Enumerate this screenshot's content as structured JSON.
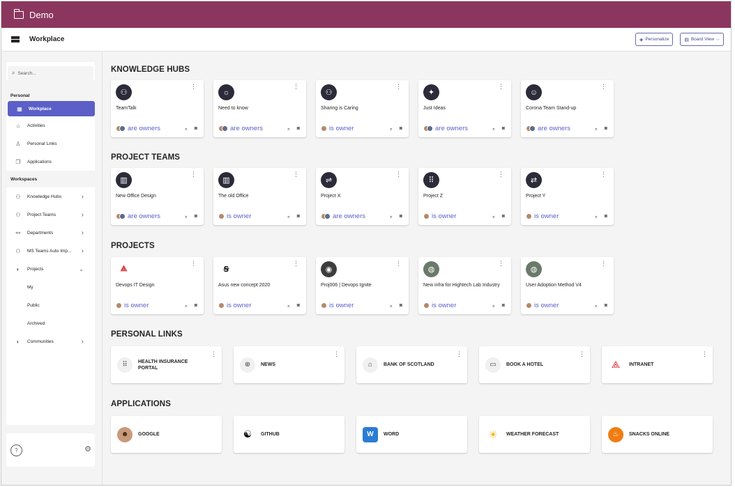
{
  "app": {
    "title": "Demo"
  },
  "header": {
    "title": "Workplace",
    "personalize_label": "Personalize",
    "board_view_label": "Board View"
  },
  "sidebar": {
    "search_placeholder": "Search...",
    "personal_label": "Personal",
    "personal_items": [
      {
        "label": "Workplace",
        "icon": "grid-icon"
      },
      {
        "label": "Activities",
        "icon": "home-icon"
      },
      {
        "label": "Personal Links",
        "icon": "person-icon"
      },
      {
        "label": "Applications",
        "icon": "copy-icon"
      }
    ],
    "workspaces_label": "Workspaces",
    "workspace_items": [
      {
        "label": "Knowledge Hubs",
        "icon": "teams-icon"
      },
      {
        "label": "Project Teams",
        "icon": "teams-icon"
      },
      {
        "label": "Departments",
        "icon": "org-icon"
      },
      {
        "label": "MS Teams Auto Imp...",
        "icon": "teams-icon"
      },
      {
        "label": "Projects",
        "icon": "planner-icon"
      }
    ],
    "project_subitems": [
      "My",
      "Public",
      "Archived"
    ],
    "communities_label": "Communities"
  },
  "sections": {
    "knowledge_hubs": {
      "title": "KNOWLEDGE HUBS",
      "cards": [
        {
          "name": "TeamTalk",
          "owner": "are owners",
          "icon": "group-icon"
        },
        {
          "name": "Need to know",
          "owner": "are owners",
          "icon": "lightbulb-head-icon"
        },
        {
          "name": "Sharing is Caring",
          "owner": "is owner",
          "icon": "group-icon"
        },
        {
          "name": "Just Ideas",
          "owner": "are owners",
          "icon": "lightbulb-icon"
        },
        {
          "name": "Corona Team Stand-up",
          "owner": "are owners",
          "icon": "face-mask-icon"
        }
      ]
    },
    "project_teams": {
      "title": "PROJECT TEAMS",
      "cards": [
        {
          "name": "New Office Design",
          "owner": "are owners",
          "icon": "building-icon"
        },
        {
          "name": "The old Office",
          "owner": "is owner",
          "icon": "building-icon"
        },
        {
          "name": "Project X",
          "owner": "are owners",
          "icon": "flow-icon"
        },
        {
          "name": "Project Z",
          "owner": "is owner",
          "icon": "grid-dots-icon"
        },
        {
          "name": "Project Y",
          "owner": "is owner",
          "icon": "swap-icon"
        }
      ]
    },
    "projects": {
      "title": "PROJECTS",
      "cards": [
        {
          "name": "Devops IT Design",
          "owner": "is owner",
          "icon": "rog-logo-icon"
        },
        {
          "name": "Asus new concept 2020",
          "owner": "is owner",
          "icon": "asus-logo-icon"
        },
        {
          "name": "Proj006 | Devops Ignite",
          "owner": "is owner",
          "icon": "disc-icon"
        },
        {
          "name": "New infra for Hightech Lab Industry",
          "owner": "is owner",
          "icon": "photo-icon"
        },
        {
          "name": "User Adoption Method V4",
          "owner": "is owner",
          "icon": "photo-icon"
        }
      ]
    },
    "personal_links": {
      "title": "PERSONAL LINKS",
      "items": [
        {
          "label": "HEALTH INSURANCE PORTAL",
          "icon": "dots-grid-icon"
        },
        {
          "label": "NEWS",
          "icon": "globe-icon"
        },
        {
          "label": "BANK OF SCOTLAND",
          "icon": "bank-icon"
        },
        {
          "label": "BOOK A HOTEL",
          "icon": "browser-icon"
        },
        {
          "label": "INTRANET",
          "icon": "rog-logo-icon"
        }
      ]
    },
    "applications": {
      "title": "APPLICATIONS",
      "items": [
        {
          "label": "GOOGLE",
          "icon": "avatar-photo-icon"
        },
        {
          "label": "GITHUB",
          "icon": "github-icon"
        },
        {
          "label": "WORD",
          "icon": "word-icon"
        },
        {
          "label": "WEATHER FORECAST",
          "icon": "weather-icon"
        },
        {
          "label": "SNACKS ONLINE",
          "icon": "snacks-icon"
        }
      ]
    }
  },
  "colors": {
    "topbar": "#8b365e",
    "accent": "#5b5fc7"
  }
}
